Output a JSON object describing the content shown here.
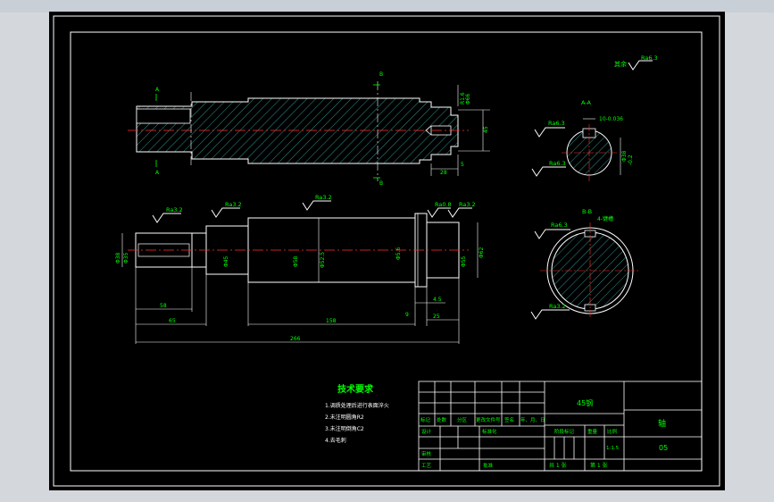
{
  "colors": {
    "background": "#000000",
    "frame": "#ffffff",
    "accent": "#00ff00",
    "hatch": "#3fd4cf",
    "centerline": "#ff3030",
    "dim_text": "#ffffff",
    "viewport": "#d4d8dd"
  },
  "surface_symbols": {
    "general": "其余",
    "general_value": "Ra6.3",
    "top_left": "Ra3.2",
    "top_mid": "Ra3.2",
    "top_right1": "Ra0.8",
    "top_right2": "Ra3.2",
    "sec_a_top": "Ra6.3",
    "sec_a_bottom": "Ra6.3",
    "sec_b_top": "Ra6.3",
    "sec_b_bottom": "Ra3.2"
  },
  "top_view": {
    "label_a_top": "A",
    "label_a_bottom": "A",
    "label_b_top": "B",
    "label_b_bottom": "B",
    "dim_right1": "R1.6",
    "dim_right2": "45",
    "dim_right3": "5",
    "dim_right4": "28",
    "dim_diam": "Φ66"
  },
  "front_view": {
    "dim_left_d1": "Φ38",
    "dim_left_d2": "Φ35",
    "dim_mid_d1": "Φ45",
    "dim_mid_d2": "Φ52.5",
    "dim_mid_d3": "Φ58",
    "dim_right_d1": "Φ62",
    "dim_right_d2": "Φ5.6",
    "dim_right_d3": "Φ55",
    "len_1": "58",
    "len_2": "65",
    "len_3": "158",
    "len_4": "4.5",
    "len_5": "9",
    "len_6": "25",
    "len_total": "266"
  },
  "section_a": {
    "title": "A-A",
    "dim_1": "10-0.036",
    "dim_2": "Φ38",
    "dim_3": "-0.2"
  },
  "section_b": {
    "title": "B-B",
    "dim_1": "4-键槽"
  },
  "tech": {
    "title": "技术要求",
    "items": [
      "1.调质处理后进行表面淬火",
      "2.未注明圆角R2",
      "3.未注明倒角C2",
      "4.去毛刺"
    ]
  },
  "title_block": {
    "material": "45钢",
    "part_name": "轴",
    "drawing_no": "05",
    "row_headers": [
      "标记",
      "处数",
      "分区",
      "更改文件号",
      "签名",
      "年、月、日"
    ],
    "design": "设计",
    "standard": "标准化",
    "review": "审核",
    "process": "工艺",
    "approve": "批准",
    "stage_mark": "阶段标记",
    "weight": "重量",
    "scale": "比例",
    "scale_value": "1:1.5",
    "sheets_total": "共 1 张",
    "sheet_no": "第 1 张"
  }
}
